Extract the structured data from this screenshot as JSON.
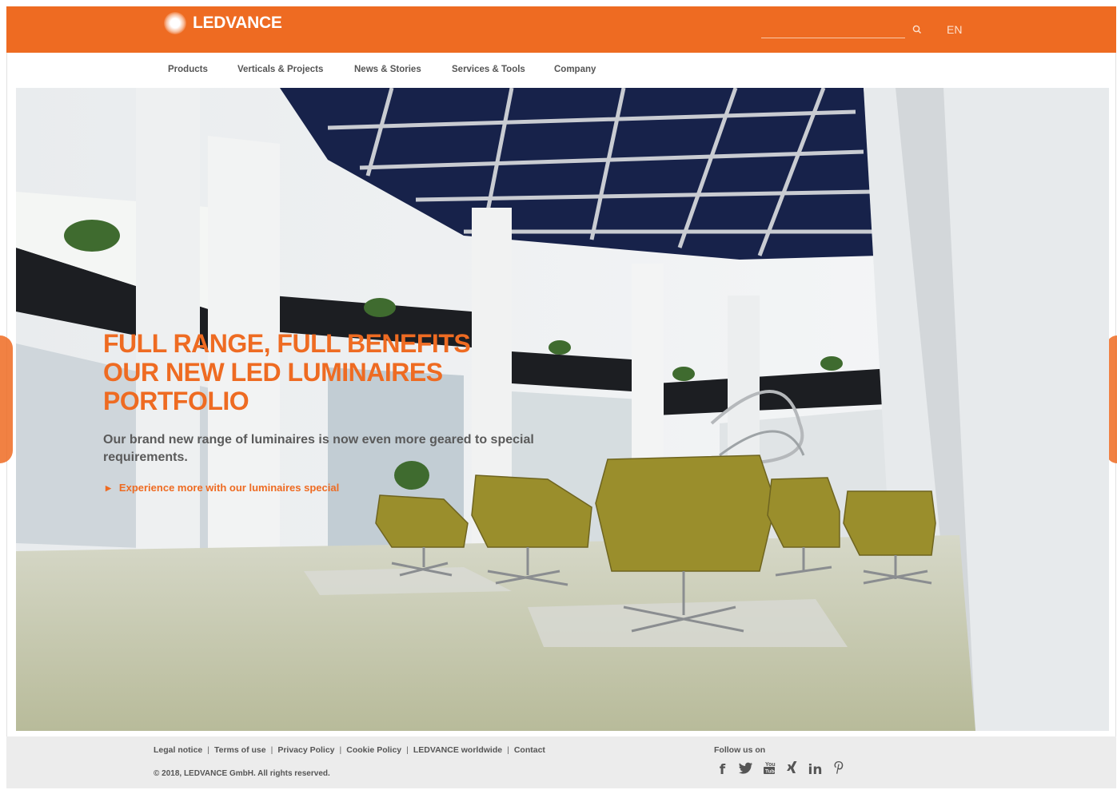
{
  "brand": {
    "name": "LEDVANCE",
    "accent": "#ee6b22"
  },
  "header": {
    "search_placeholder": "",
    "language": "EN",
    "search_icon": "search-icon"
  },
  "nav": {
    "items": [
      {
        "label": "Products"
      },
      {
        "label": "Verticals & Projects"
      },
      {
        "label": "News & Stories"
      },
      {
        "label": "Services & Tools"
      },
      {
        "label": "Company"
      }
    ]
  },
  "hero": {
    "title_lines": [
      "FULL RANGE, FULL BENEFITS",
      "OUR NEW LED LUMINAIRES",
      "PORTFOLIO"
    ],
    "description": "Our brand new range of luminaires is now even more geared to special requirements.",
    "link_label": "Experience more with our luminaires special"
  },
  "footer": {
    "links": [
      {
        "label": "Legal notice"
      },
      {
        "label": "Terms of use"
      },
      {
        "label": "Privacy Policy"
      },
      {
        "label": "Cookie Policy"
      },
      {
        "label": "LEDVANCE worldwide"
      },
      {
        "label": "Contact"
      }
    ],
    "copyright": "© 2018, LEDVANCE GmbH. All rights reserved.",
    "follow_label": "Follow us on",
    "social": [
      {
        "icon": "facebook-icon",
        "glyph": "f"
      },
      {
        "icon": "twitter-icon",
        "glyph": "🐦"
      },
      {
        "icon": "youtube-icon",
        "glyph": "▣"
      },
      {
        "icon": "xing-icon",
        "glyph": "χ"
      },
      {
        "icon": "linkedin-icon",
        "glyph": "in"
      },
      {
        "icon": "pinterest-icon",
        "glyph": "𝓅"
      }
    ]
  }
}
